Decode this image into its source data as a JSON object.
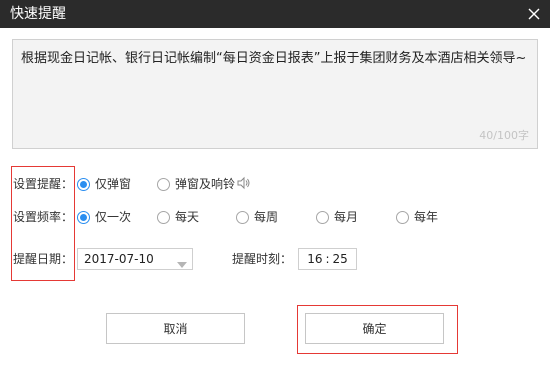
{
  "window": {
    "title": "快速提醒",
    "close_icon": "close-icon"
  },
  "message": {
    "text": "根据现金日记帐、银行日记帐编制“每日资金日报表”上报于集团财务及本酒店相关领导~",
    "counter": "40/100字"
  },
  "reminder_type": {
    "label": "设置提醒：",
    "options": [
      {
        "label": "仅弹窗",
        "checked": true
      },
      {
        "label": "弹窗及响铃",
        "checked": false
      }
    ],
    "sound_icon": "speaker-icon"
  },
  "frequency": {
    "label": "设置频率：",
    "options": [
      {
        "label": "仅一次",
        "checked": true
      },
      {
        "label": "每天",
        "checked": false
      },
      {
        "label": "每周",
        "checked": false
      },
      {
        "label": "每月",
        "checked": false
      },
      {
        "label": "每年",
        "checked": false
      }
    ]
  },
  "date": {
    "label": "提醒日期：",
    "value": "2017-07-10",
    "dropdown_icon": "chevron-down-icon"
  },
  "time": {
    "label": "提醒时刻：",
    "hour": "16",
    "separator": ":",
    "minute": "25"
  },
  "buttons": {
    "cancel": "取消",
    "confirm": "确定"
  },
  "colors": {
    "titlebar": "#2b2b2b",
    "accent": "#2a8ef0",
    "highlight": "#e53935",
    "textarea_bg": "#f3f3f3"
  }
}
